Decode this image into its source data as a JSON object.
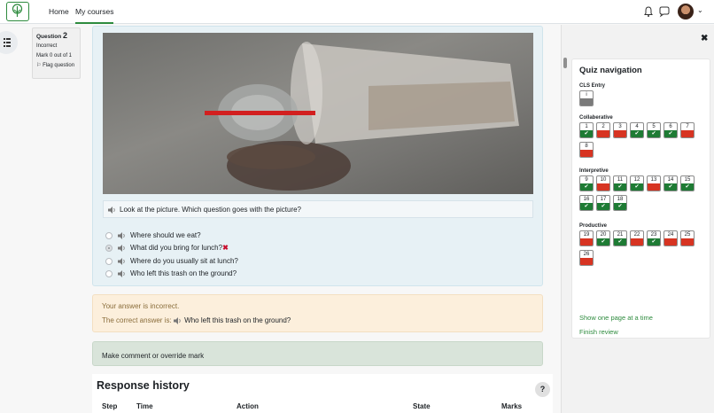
{
  "navbar": {
    "home_label": "Home",
    "courses_label": "My courses"
  },
  "question_info": {
    "question_prefix": "Question",
    "question_number": "2",
    "state": "Incorrect",
    "mark": "Mark 0 out of 1",
    "flag_label": "Flag question"
  },
  "question": {
    "prompt": "Look at the picture. Which question goes with the picture?",
    "answers": [
      {
        "text": "Where should we eat?",
        "selected": false,
        "wrong": false
      },
      {
        "text": "What did you bring for lunch?",
        "selected": true,
        "wrong": true
      },
      {
        "text": "Where do you usually sit at lunch?",
        "selected": false,
        "wrong": false
      },
      {
        "text": "Who left this trash on the ground?",
        "selected": false,
        "wrong": false
      }
    ],
    "wrong_mark": "✖"
  },
  "feedback": {
    "incorrect_text": "Your answer is incorrect.",
    "correct_prefix": "The correct answer is:",
    "correct_answer": "Who left this trash on the ground?"
  },
  "comment_label": "Make comment or override mark",
  "history": {
    "title": "Response history",
    "help": "?",
    "columns": [
      "Step",
      "Time",
      "Action",
      "State",
      "Marks"
    ]
  },
  "quiz_nav": {
    "title": "Quiz navigation",
    "close": "✖",
    "sections": [
      {
        "title": "CLS Entry",
        "questions": [
          {
            "n": "i",
            "state": "info"
          }
        ]
      },
      {
        "title": "Collaberative",
        "questions": [
          {
            "n": "1",
            "state": "correct"
          },
          {
            "n": "2",
            "state": "incorrect"
          },
          {
            "n": "3",
            "state": "incorrect"
          },
          {
            "n": "4",
            "state": "correct"
          },
          {
            "n": "5",
            "state": "correct"
          },
          {
            "n": "6",
            "state": "correct"
          },
          {
            "n": "7",
            "state": "incorrect"
          },
          {
            "n": "8",
            "state": "incorrect"
          }
        ]
      },
      {
        "title": "Interpretive",
        "questions": [
          {
            "n": "9",
            "state": "correct"
          },
          {
            "n": "10",
            "state": "incorrect"
          },
          {
            "n": "11",
            "state": "correct"
          },
          {
            "n": "12",
            "state": "correct"
          },
          {
            "n": "13",
            "state": "incorrect"
          },
          {
            "n": "14",
            "state": "correct"
          },
          {
            "n": "15",
            "state": "correct"
          },
          {
            "n": "16",
            "state": "correct"
          },
          {
            "n": "17",
            "state": "correct"
          },
          {
            "n": "18",
            "state": "correct"
          }
        ]
      },
      {
        "title": "Productive",
        "questions": [
          {
            "n": "19",
            "state": "incorrect"
          },
          {
            "n": "20",
            "state": "correct"
          },
          {
            "n": "21",
            "state": "correct"
          },
          {
            "n": "22",
            "state": "incorrect"
          },
          {
            "n": "23",
            "state": "correct"
          },
          {
            "n": "24",
            "state": "incorrect"
          },
          {
            "n": "25",
            "state": "incorrect"
          },
          {
            "n": "26",
            "state": "incorrect"
          }
        ]
      }
    ],
    "show_one_page": "Show one page at a time",
    "finish_review": "Finish review"
  },
  "colors": {
    "brand": "#2e8b3e",
    "correct": "#1e7b34",
    "incorrect": "#d73422"
  }
}
